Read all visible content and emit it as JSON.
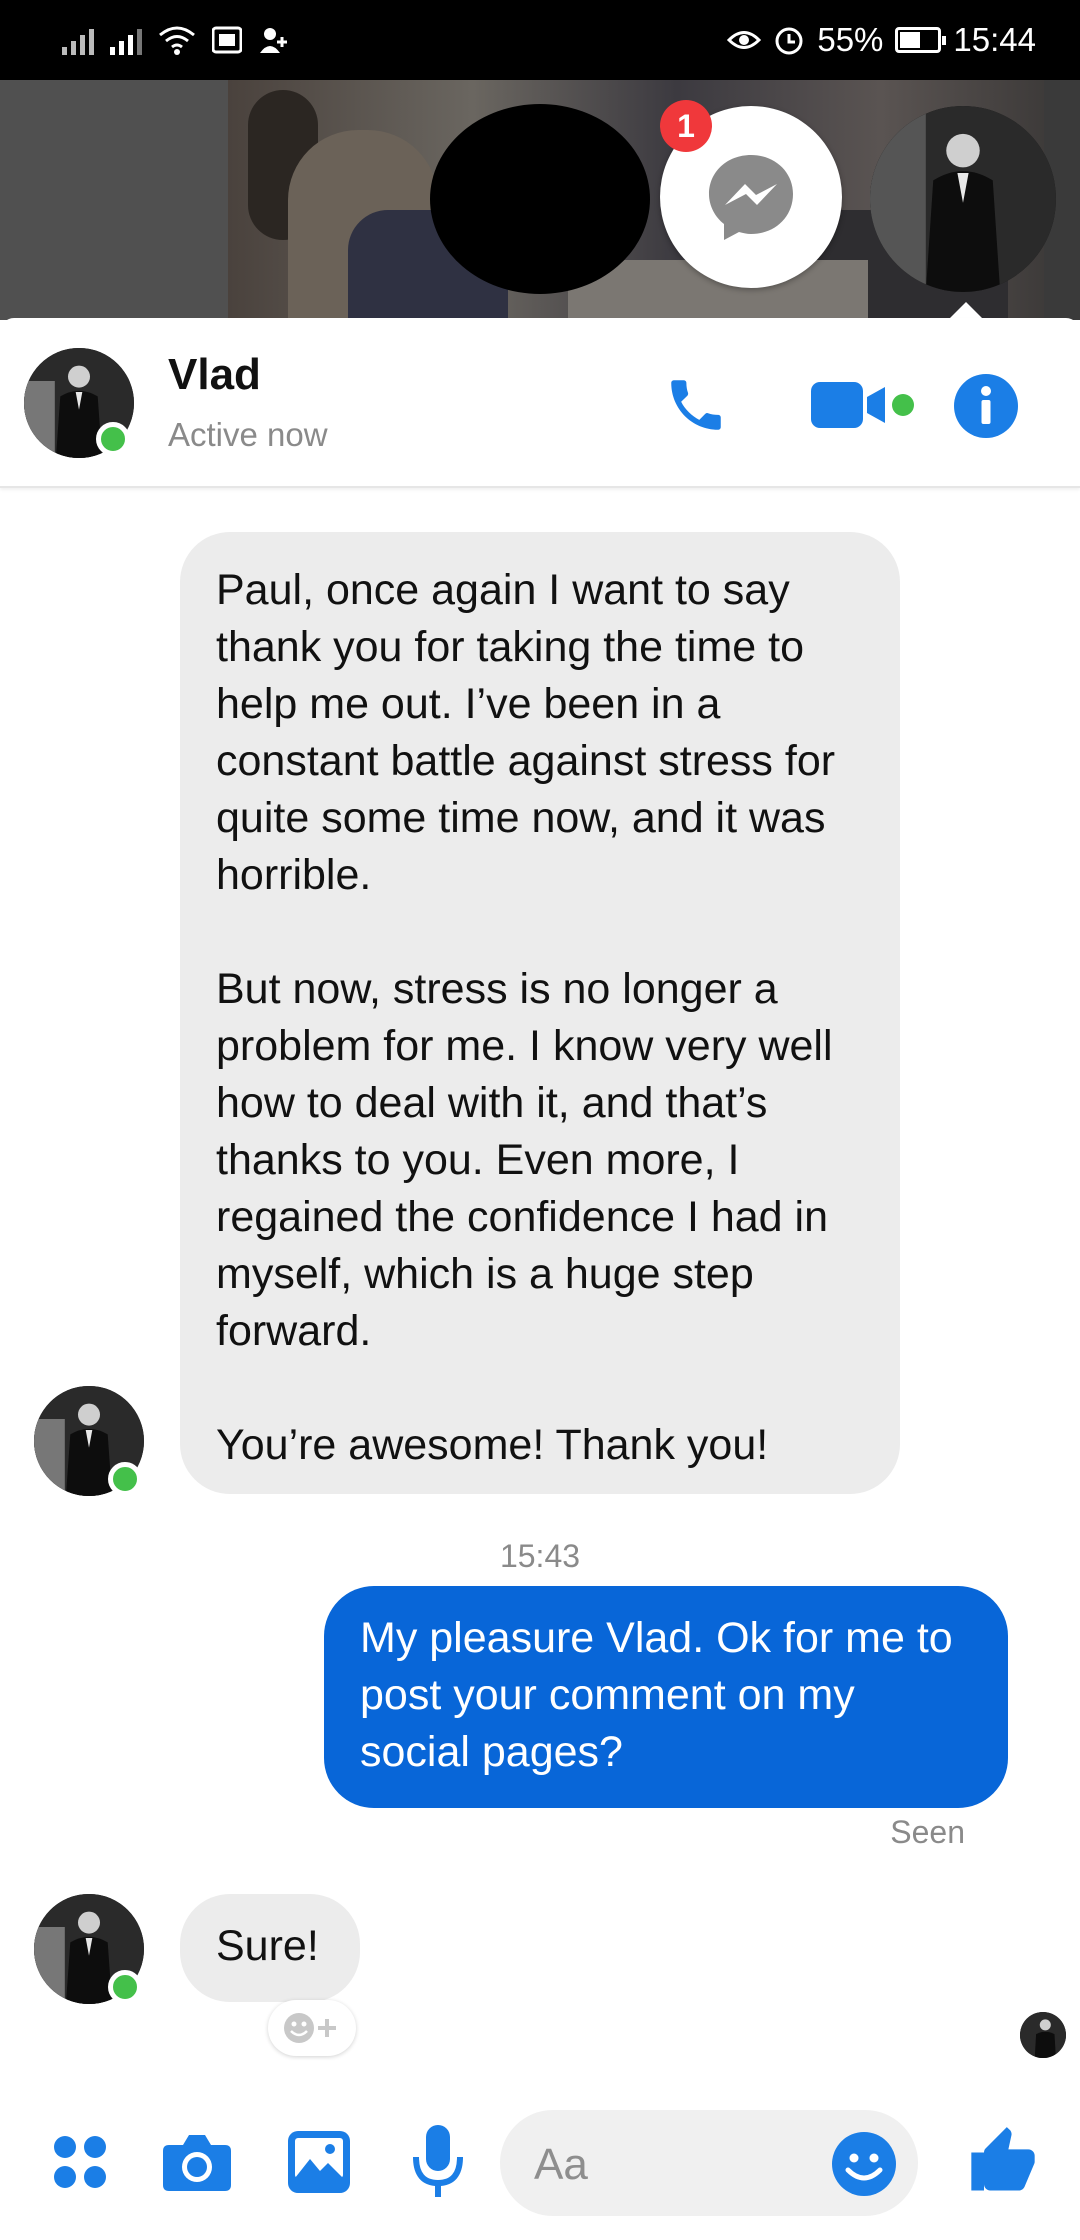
{
  "status_bar": {
    "battery": "55%",
    "time": "15:44",
    "battery_level": 0.55
  },
  "chat_head": {
    "badge_count": "1"
  },
  "header": {
    "name": "Vlad",
    "status": "Active now"
  },
  "messages": {
    "incoming_1": {
      "para1": "Paul, once again I want to say thank you for taking the time to help me out. I’ve been in a constant battle against stress for quite some time now, and it was horrible.",
      "para2": "But now, stress is no longer a problem for me. I know very well how to deal with it, and that’s thanks to you. Even more, I regained the confidence I had in myself, which is a huge step forward.",
      "para3": "You’re awesome! Thank you!"
    },
    "timestamp": "15:43",
    "outgoing_1": "My pleasure Vlad. Ok for me to post your comment on my social pages?",
    "seen_label": "Seen",
    "incoming_2": "Sure!"
  },
  "composer": {
    "placeholder": "Aa"
  },
  "colors": {
    "accent": "#0866d8",
    "icon_blue": "#1b7ee6",
    "online": "#44c04a",
    "badge": "#f0383b"
  },
  "icons": {
    "more": "apps-grid-icon",
    "camera": "camera-icon",
    "gallery": "image-icon",
    "mic": "microphone-icon",
    "emoji": "emoji-icon",
    "like": "thumbs-up-icon",
    "call": "phone-icon",
    "video": "video-camera-icon",
    "info": "info-icon"
  }
}
